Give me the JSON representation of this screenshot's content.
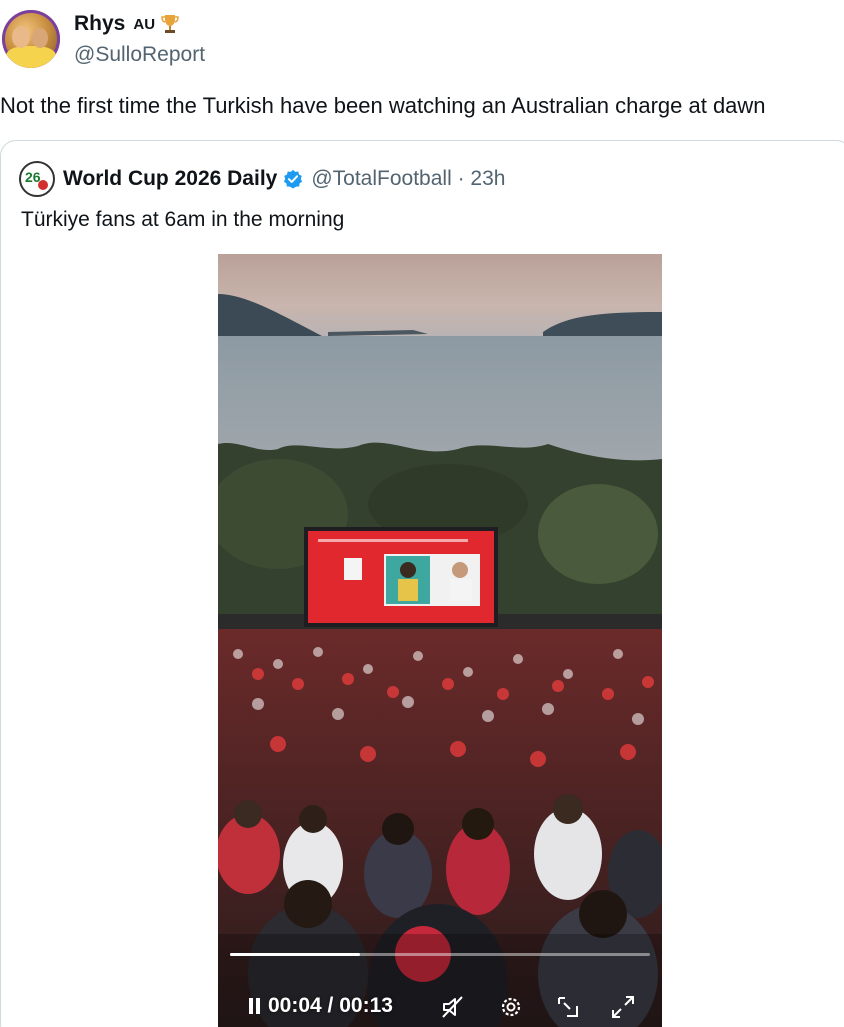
{
  "tweet": {
    "author": {
      "display_name": "Rhys",
      "country_tag": "AU",
      "badge_icon": "trophy-icon",
      "handle": "@SulloReport"
    },
    "text": "Not the first time the Turkish have been watching an Australian charge at dawn"
  },
  "quoted_tweet": {
    "author": {
      "display_name": "World Cup 2026 Daily",
      "verified": true,
      "handle_time": "@TotalFootball · 23h"
    },
    "text": "Türkiye fans at 6am in the morning",
    "video": {
      "current_time": "00:04",
      "duration": "00:13",
      "time_display": "00:04 / 00:13",
      "progress_fraction": 0.31,
      "controls": [
        "pause-icon",
        "mute-icon",
        "settings-icon",
        "pip-icon",
        "fullscreen-icon"
      ]
    }
  },
  "colors": {
    "text_primary": "#0f1419",
    "text_secondary": "#536471",
    "verified_blue": "#1d9bf0",
    "border": "#cfd9de",
    "screen_red": "#e0282e"
  }
}
